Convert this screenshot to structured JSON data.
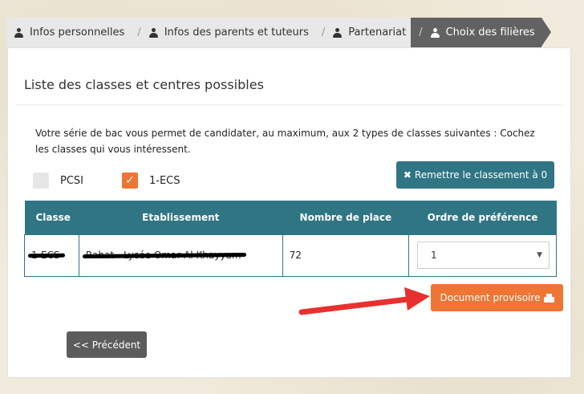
{
  "steps": [
    {
      "label": "Infos personnelles",
      "active": false
    },
    {
      "label": "Infos des parents et tuteurs",
      "active": false
    },
    {
      "label": "Partenariat",
      "active": false
    },
    {
      "label": "Choix des filières",
      "active": true
    }
  ],
  "steps_separator": "/",
  "panel": {
    "title": "Liste des classes et centres possibles",
    "intro": "Votre série de bac vous permet de candidater, au maximum, aux 2 types de classes suivantes : Cochez les classes qui vous intéressent."
  },
  "checkboxes": [
    {
      "label": "PCSI",
      "checked": false
    },
    {
      "label": "1-ECS",
      "checked": true
    }
  ],
  "checkmark": "✓",
  "buttons": {
    "reset": {
      "icon": "✖",
      "label": "Remettre le classement à 0"
    },
    "document": "Document provisoire",
    "previous": "<< Précédent"
  },
  "table": {
    "headers": [
      "Classe",
      "Etablissement",
      "Nombre de place",
      "Ordre de préférence"
    ],
    "rows": [
      {
        "classe": "1-ECS",
        "etablissement": "Rabat - Lycée Omar Al Khayyam",
        "places": "72",
        "ordre": "1"
      }
    ]
  },
  "select_caret": "▼",
  "colors": {
    "teal": "#2f7583",
    "orange": "#ee7534",
    "active_step": "#626262",
    "arrow": "#e8312f"
  }
}
